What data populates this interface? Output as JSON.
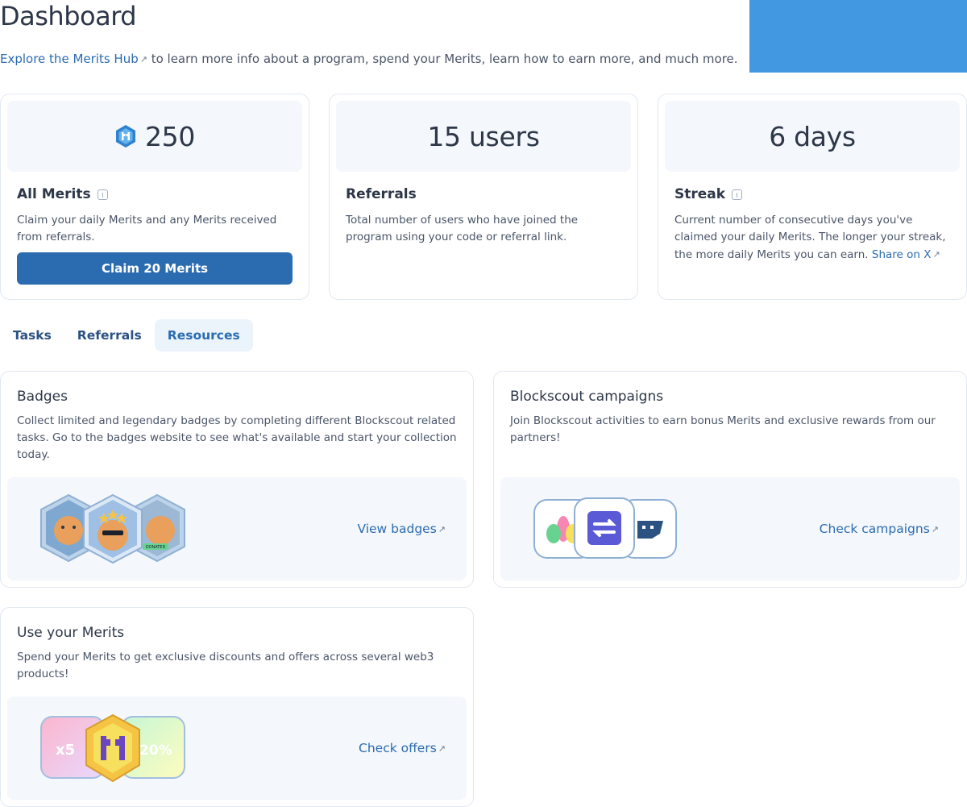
{
  "header": {
    "title": "Dashboard",
    "hub_link": "Explore the Merits Hub",
    "intro": " to learn more info about a program, spend your Merits, learn how to earn more, and much more."
  },
  "stats": {
    "merits": {
      "value": "250",
      "label": "All Merits",
      "description": "Claim your daily Merits and any Merits received from referrals.",
      "button": "Claim 20 Merits"
    },
    "referrals": {
      "value": "15 users",
      "label": "Referrals",
      "description": "Total number of users who have joined the program using your code or referral link."
    },
    "streak": {
      "value": "6 days",
      "label": "Streak",
      "description": "Current number of consecutive days you've claimed your daily Merits. The longer your streak, the more daily Merits you can earn. ",
      "share_link": "Share on X"
    }
  },
  "tabs": [
    {
      "label": "Tasks",
      "active": false
    },
    {
      "label": "Referrals",
      "active": false
    },
    {
      "label": "Resources",
      "active": true
    }
  ],
  "resources": {
    "badges": {
      "title": "Badges",
      "description": "Collect limited and legendary badges by completing different Blockscout related tasks. Go to the badges website to see what's available and start your collection today.",
      "action": "View badges",
      "badge_text": "DONATED"
    },
    "campaigns": {
      "title": "Blockscout campaigns",
      "description": "Join Blockscout activities to earn bonus Merits and exclusive rewards from our partners!",
      "action": "Check campaigns"
    },
    "offers": {
      "title": "Use your Merits",
      "description": "Spend your Merits to get exclusive discounts and offers across several web3 products!",
      "action": "Check offers",
      "multiplier": "x5",
      "discount": "20%"
    }
  },
  "colors": {
    "accent": "#2b6cb0",
    "banner": "#4299e1",
    "panel_bg": "#f4f7fb"
  }
}
